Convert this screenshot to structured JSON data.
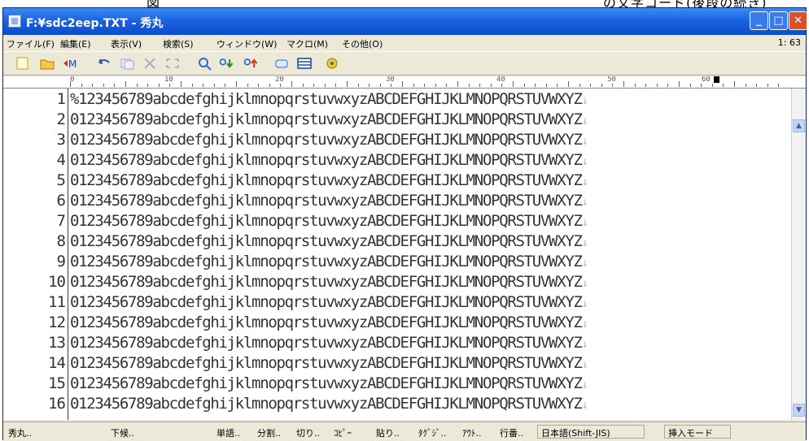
{
  "caption_fragment": "図　　　　　　　　　　　　　　　　　　　　　　　　　　　　　　　　の文字コード(後段の続き)",
  "window": {
    "title": "F:¥sdc2eep.TXT - 秀丸"
  },
  "menu": {
    "items": [
      "ファイル(F)",
      "編集(E)",
      "表示(V)",
      "検索(S)",
      "ウィンドウ(W)",
      "マクロ(M)",
      "その他(O)"
    ],
    "position": "1: 63"
  },
  "toolbar": {
    "icons": [
      "new-file-icon",
      "open-folder-icon",
      "save-icon",
      "undo-icon",
      "copy-icon",
      "cut-icon",
      "paste-icon",
      "find-icon",
      "find-down-icon",
      "find-up-icon",
      "jump-icon",
      "split-window-icon",
      "help-icon"
    ]
  },
  "ruler": {
    "marks": [
      "0",
      "10",
      "20",
      "30",
      "40",
      "50",
      "60"
    ]
  },
  "editor": {
    "lines": [
      {
        "n": "1",
        "text": "%123456789abcdefghijklmnopqrstuvwxyzABCDEFGHIJKLMNOPQRSTUVWXYZ"
      },
      {
        "n": "2",
        "text": "0123456789abcdefghijklmnopqrstuvwxyzABCDEFGHIJKLMNOPQRSTUVWXYZ"
      },
      {
        "n": "3",
        "text": "0123456789abcdefghijklmnopqrstuvwxyzABCDEFGHIJKLMNOPQRSTUVWXYZ"
      },
      {
        "n": "4",
        "text": "0123456789abcdefghijklmnopqrstuvwxyzABCDEFGHIJKLMNOPQRSTUVWXYZ"
      },
      {
        "n": "5",
        "text": "0123456789abcdefghijklmnopqrstuvwxyzABCDEFGHIJKLMNOPQRSTUVWXYZ"
      },
      {
        "n": "6",
        "text": "0123456789abcdefghijklmnopqrstuvwxyzABCDEFGHIJKLMNOPQRSTUVWXYZ"
      },
      {
        "n": "7",
        "text": "0123456789abcdefghijklmnopqrstuvwxyzABCDEFGHIJKLMNOPQRSTUVWXYZ"
      },
      {
        "n": "8",
        "text": "0123456789abcdefghijklmnopqrstuvwxyzABCDEFGHIJKLMNOPQRSTUVWXYZ"
      },
      {
        "n": "9",
        "text": "0123456789abcdefghijklmnopqrstuvwxyzABCDEFGHIJKLMNOPQRSTUVWXYZ"
      },
      {
        "n": "10",
        "text": "0123456789abcdefghijklmnopqrstuvwxyzABCDEFGHIJKLMNOPQRSTUVWXYZ"
      },
      {
        "n": "11",
        "text": "0123456789abcdefghijklmnopqrstuvwxyzABCDEFGHIJKLMNOPQRSTUVWXYZ"
      },
      {
        "n": "12",
        "text": "0123456789abcdefghijklmnopqrstuvwxyzABCDEFGHIJKLMNOPQRSTUVWXYZ"
      },
      {
        "n": "13",
        "text": "0123456789abcdefghijklmnopqrstuvwxyzABCDEFGHIJKLMNOPQRSTUVWXYZ"
      },
      {
        "n": "14",
        "text": "0123456789abcdefghijklmnopqrstuvwxyzABCDEFGHIJKLMNOPQRSTUVWXYZ"
      },
      {
        "n": "15",
        "text": "0123456789abcdefghijklmnopqrstuvwxyzABCDEFGHIJKLMNOPQRSTUVWXYZ"
      },
      {
        "n": "16",
        "text": "0123456789abcdefghijklmnopqrstuvwxyzABCDEFGHIJKLMNOPQRSTUVWXYZ"
      }
    ],
    "eol_mark": "↓"
  },
  "status": {
    "left": [
      "秀丸..",
      "下候.."
    ],
    "tools": [
      "単語..",
      "分割..",
      "切り..",
      "ｺﾋﾟｰ",
      "貼り..",
      "ﾀｸﾞｼﾞ..",
      "ｱｳﾄ..",
      "行番.."
    ],
    "encoding": "日本語(Shift-JIS)",
    "mode": "挿入モード"
  },
  "colors": {
    "title_bar": "#1c63e0",
    "close_button": "#d9522b",
    "gutter_line": "#cc0000",
    "chrome": "#ece9d8"
  }
}
